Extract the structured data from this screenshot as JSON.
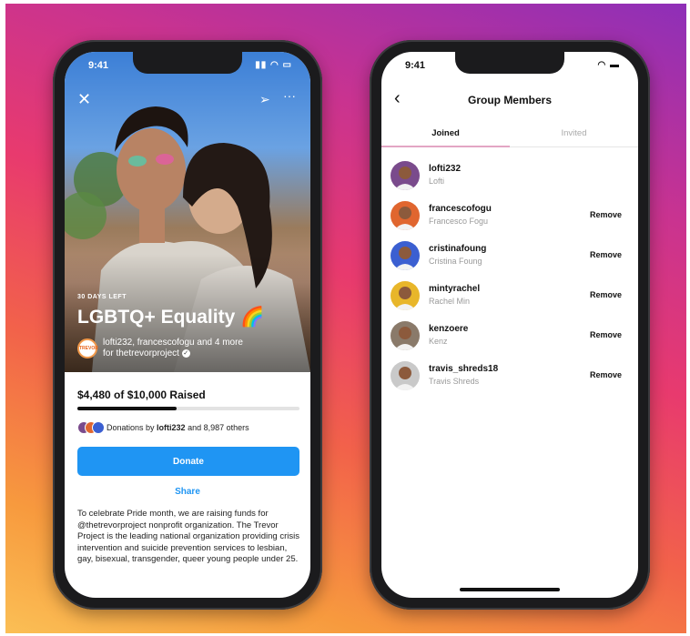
{
  "fundraiser": {
    "status_time": "9:41",
    "days_left": "30 DAYS LEFT",
    "title": "LGBTQ+ Equality 🌈",
    "org_badge_text": "TREVOR",
    "organizers_line": "lofti232, francescofogu and 4 more",
    "for_line": "for thetrevorproject",
    "raised_text": "$4,480 of $10,000 Raised",
    "progress": 0.448,
    "donors_prefix": "Donations by ",
    "donors_user": "lofti232",
    "donors_suffix": " and 8,987 others",
    "donate_label": "Donate",
    "share_label": "Share",
    "description": "To celebrate Pride month, we are raising funds for @thetrevorproject nonprofit organization. The Trevor Project is the leading national organization providing crisis intervention and suicide prevention services to lesbian, gay, bisexual, transgender, queer young people under 25.",
    "icons": {
      "close": "close-icon",
      "send": "send-icon",
      "more": "more-icon",
      "verified": "verified-icon"
    }
  },
  "members_screen": {
    "status_time": "9:41",
    "title": "Group Members",
    "tabs": [
      {
        "label": "Joined",
        "active": true
      },
      {
        "label": "Invited",
        "active": false
      }
    ],
    "remove_label": "Remove",
    "members": [
      {
        "username": "lofti232",
        "name": "Lofti",
        "removable": false,
        "avatar_color": "#7a4b8c"
      },
      {
        "username": "francescofogu",
        "name": "Francesco Fogu",
        "removable": true,
        "avatar_color": "#e0662f"
      },
      {
        "username": "cristinafoung",
        "name": "Cristina Foung",
        "removable": true,
        "avatar_color": "#3b5fd1"
      },
      {
        "username": "mintyrachel",
        "name": "Rachel Min",
        "removable": true,
        "avatar_color": "#e8b62a"
      },
      {
        "username": "kenzoere",
        "name": "Kenz",
        "removable": true,
        "avatar_color": "#8a7a6a"
      },
      {
        "username": "travis_shreds18",
        "name": "Travis Shreds",
        "removable": true,
        "avatar_color": "#c9c9c9"
      }
    ]
  },
  "colors": {
    "accent": "#1f95f3",
    "text": "#111111",
    "secondary_text": "#999999"
  }
}
